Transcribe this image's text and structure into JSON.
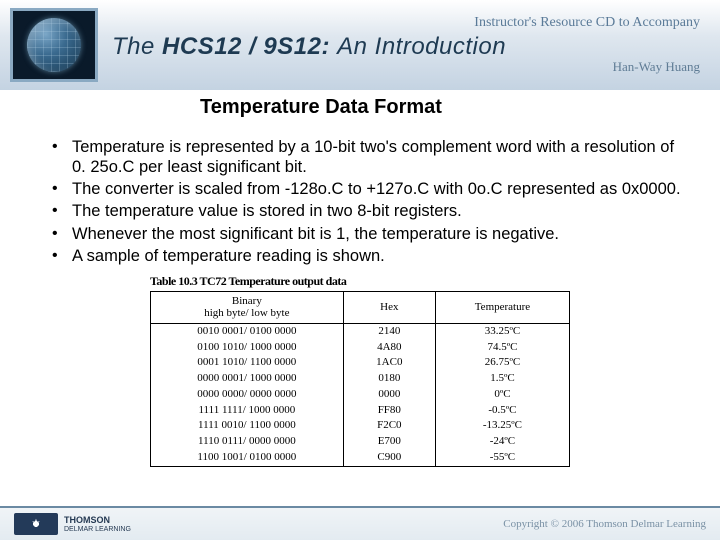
{
  "header": {
    "instructors_line": "Instructor's Resource CD to Accompany",
    "title_the": "The",
    "title_main": "HCS12 / 9S12:",
    "title_sub": "An Introduction",
    "author": "Han-Way Huang"
  },
  "slide": {
    "title": "Temperature Data Format",
    "bullets": [
      "Temperature is represented by a 10-bit two's complement word with a resolution of 0. 25o.C per least significant bit.",
      "The converter is scaled from -128o.C to +127o.C with 0o.C represented as 0x0000.",
      "The temperature value is stored in two 8-bit registers.",
      "Whenever the most significant bit is 1, the temperature is negative.",
      "A sample of temperature reading is shown."
    ]
  },
  "table": {
    "caption": "Table 10.3 TC72 Temperature output data",
    "headers": [
      "Binary\nhigh byte/ low byte",
      "Hex",
      "Temperature"
    ],
    "rows": [
      [
        "0010 0001/ 0100 0000",
        "2140",
        "33.25ºC"
      ],
      [
        "0100 1010/ 1000 0000",
        "4A80",
        "74.5ºC"
      ],
      [
        "0001 1010/ 1100 0000",
        "1AC0",
        "26.75ºC"
      ],
      [
        "0000 0001/ 1000 0000",
        "0180",
        "1.5ºC"
      ],
      [
        "0000 0000/ 0000 0000",
        "0000",
        "0ºC"
      ],
      [
        "1111 1111/ 1000 0000",
        "FF80",
        "-0.5ºC"
      ],
      [
        "1111 0010/ 1100 0000",
        "F2C0",
        "-13.25ºC"
      ],
      [
        "1110 0111/ 0000 0000",
        "E700",
        "-24ºC"
      ],
      [
        "1100 1001/ 0100 0000",
        "C900",
        "-55ºC"
      ]
    ]
  },
  "footer": {
    "brand_top": "THOMSON",
    "brand_sub": "DELMAR LEARNING",
    "copyright": "Copyright © 2006 Thomson Delmar Learning"
  }
}
